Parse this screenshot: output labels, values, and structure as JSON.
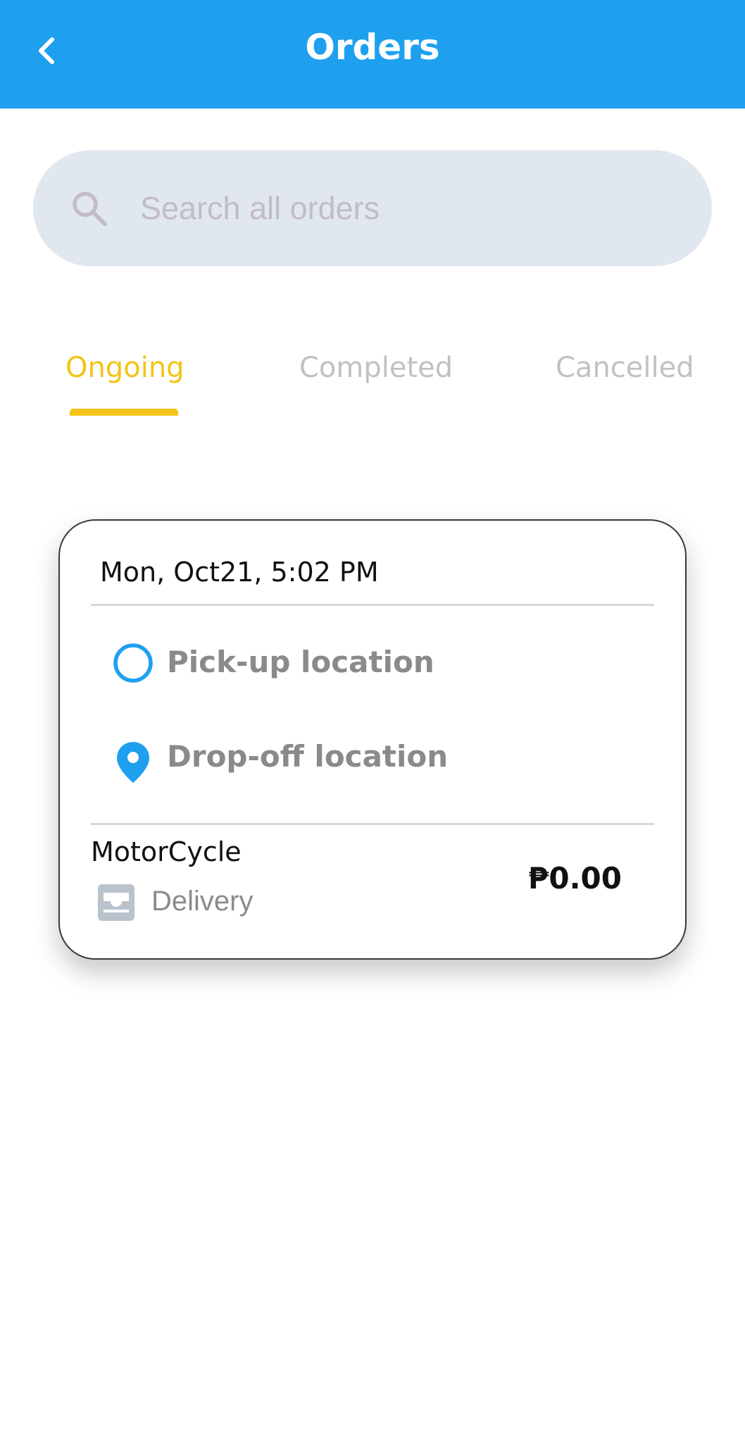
{
  "header": {
    "title": "Orders",
    "background_color": "#1ea0ef",
    "back_icon": "chevron-left-icon"
  },
  "search": {
    "placeholder": "Search all orders",
    "value": "",
    "icon": "search-icon"
  },
  "tabs": [
    {
      "label": "Ongoing",
      "active": true,
      "color": "#f2c417"
    },
    {
      "label": "Completed",
      "active": false,
      "color": "#c1c1c5"
    },
    {
      "label": "Cancelled",
      "active": false,
      "color": "#c1c1c5"
    }
  ],
  "orders": [
    {
      "datetime": "Mon, Oct21, 5:02 PM",
      "pickup_label": "Pick-up location",
      "pickup_icon": "ring-marker-icon",
      "dropoff_label": "Drop-off location",
      "dropoff_icon": "map-pin-icon",
      "vehicle": "MotorCycle",
      "service_type": "Delivery",
      "service_icon": "inbox-tray-icon",
      "price": "₱0.00"
    }
  ],
  "colors": {
    "accent_blue": "#1ea0ef",
    "accent_yellow": "#f2c417",
    "search_bg": "#e1e7ef",
    "muted_text": "#8a8a8a"
  }
}
